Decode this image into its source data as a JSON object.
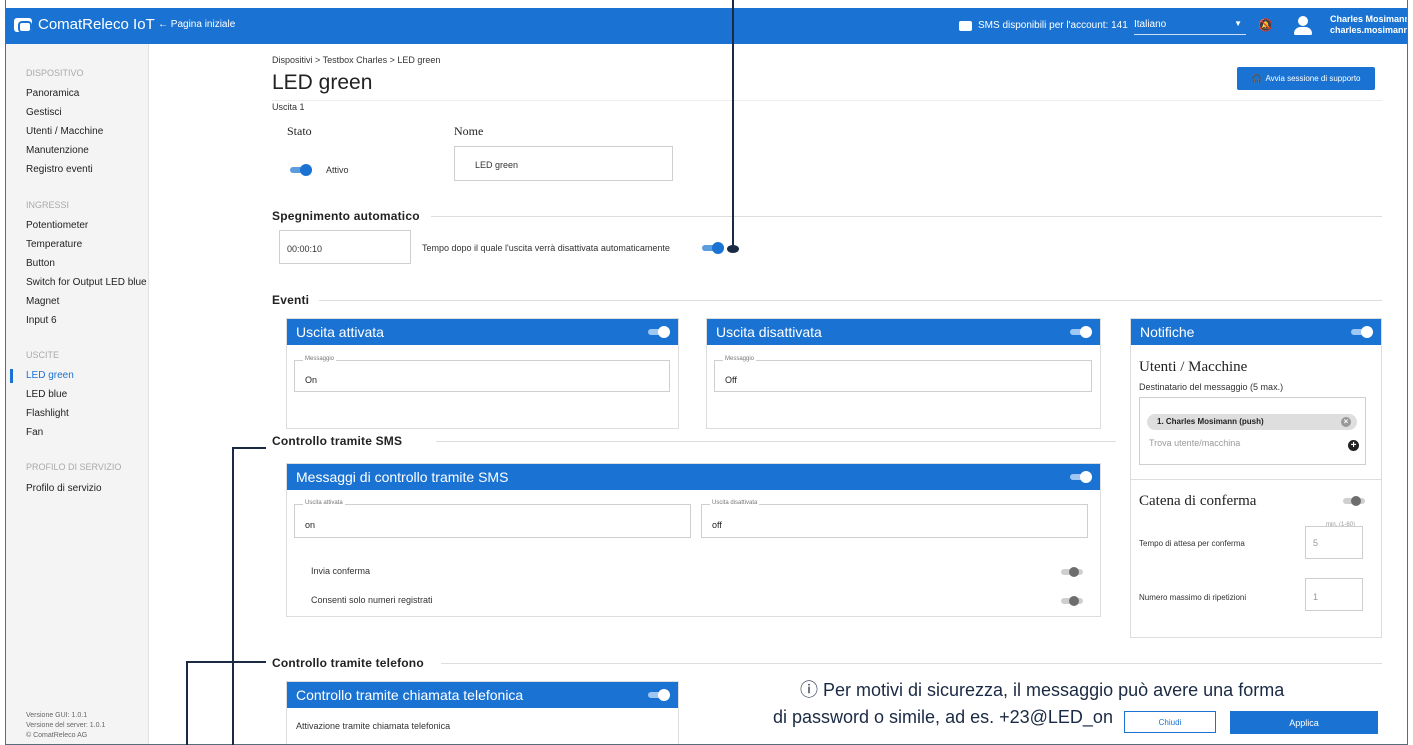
{
  "app": {
    "name": "ComatReleco IoT",
    "back_label": "← Pagina iniziale"
  },
  "topbar": {
    "sms_label": "SMS disponibili per l'account: 141",
    "language": "Italiano",
    "user_name": "Charles Mosimann",
    "user_email": "charles.mosimann"
  },
  "sidebar": {
    "dispositivo_header": "DISPOSITIVO",
    "dispositivo_items": [
      "Panoramica",
      "Gestisci",
      "Utenti / Macchine",
      "Manutenzione",
      "Registro eventi"
    ],
    "ingressi_header": "INGRESSI",
    "ingressi_items": [
      "Potentiometer",
      "Temperature",
      "Button",
      "Switch for Output LED blue",
      "Magnet",
      "Input 6"
    ],
    "uscite_header": "USCITE",
    "uscite_items": [
      "LED green",
      "LED blue",
      "Flashlight",
      "Fan"
    ],
    "profilo_header": "PROFILO DI SERVIZIO",
    "profilo_items": [
      "Profilo di servizio"
    ],
    "version_gui": "Versione GUI: 1.0.1",
    "version_server": "Versione del server: 1.0.1",
    "copyright": "© ComatReleco AG"
  },
  "page": {
    "breadcrumb": "Dispositivi > Testbox Charles > LED green",
    "title": "LED green",
    "subtitle": "Uscita 1",
    "support_button": "Avvia sessione di supporto",
    "stato_label": "Stato",
    "nome_label": "Nome",
    "stato_value": "Attivo",
    "nome_value": "LED green"
  },
  "spegnimento": {
    "title": "Spegnimento automatico",
    "time_value": "00:00:10",
    "description": "Tempo dopo il quale l'uscita verrà disattivata automaticamente"
  },
  "eventi": {
    "title": "Eventi",
    "card_on": {
      "title": "Uscita attivata",
      "field_label": "Messaggio",
      "value": "On"
    },
    "card_off": {
      "title": "Uscita disattivata",
      "field_label": "Messaggio",
      "value": "Off"
    }
  },
  "notifiche": {
    "title": "Notifiche",
    "users_title": "Utenti / Macchine",
    "recipients_label": "Destinatario del messaggio (5 max.)",
    "chip": "1. Charles Mosimann (push)",
    "search_placeholder": "Trova utente/macchina",
    "catena_title": "Catena di conferma",
    "wait_label": "Tempo di attesa per conferma",
    "wait_hint": "min. (1-60)",
    "wait_value": "5",
    "repeat_label": "Numero massimo di ripetizioni",
    "repeat_value": "1"
  },
  "sms": {
    "section_title": "Controllo tramite SMS",
    "card_title": "Messaggi di controllo tramite SMS",
    "on_label": "Uscita attivata",
    "on_value": "on",
    "off_label": "Uscita disattivata",
    "off_value": "off",
    "confirm_label": "Invia conferma",
    "registered_label": "Consenti solo numeri registrati"
  },
  "telefono": {
    "section_title": "Controllo tramite telefono",
    "card_title": "Controllo tramite chiamata telefonica",
    "activation_label": "Attivazione tramite chiamata telefonica"
  },
  "footer": {
    "close_button": "Chiudi",
    "apply_button": "Applica"
  },
  "annotation": {
    "line1": "ⓘ Per motivi di sicurezza, il messaggio può avere una forma",
    "line2": "di password o simile, ad es. +23@LED_on"
  },
  "colors": {
    "primary": "#1a73d2",
    "annotation": "#1b2a44"
  }
}
